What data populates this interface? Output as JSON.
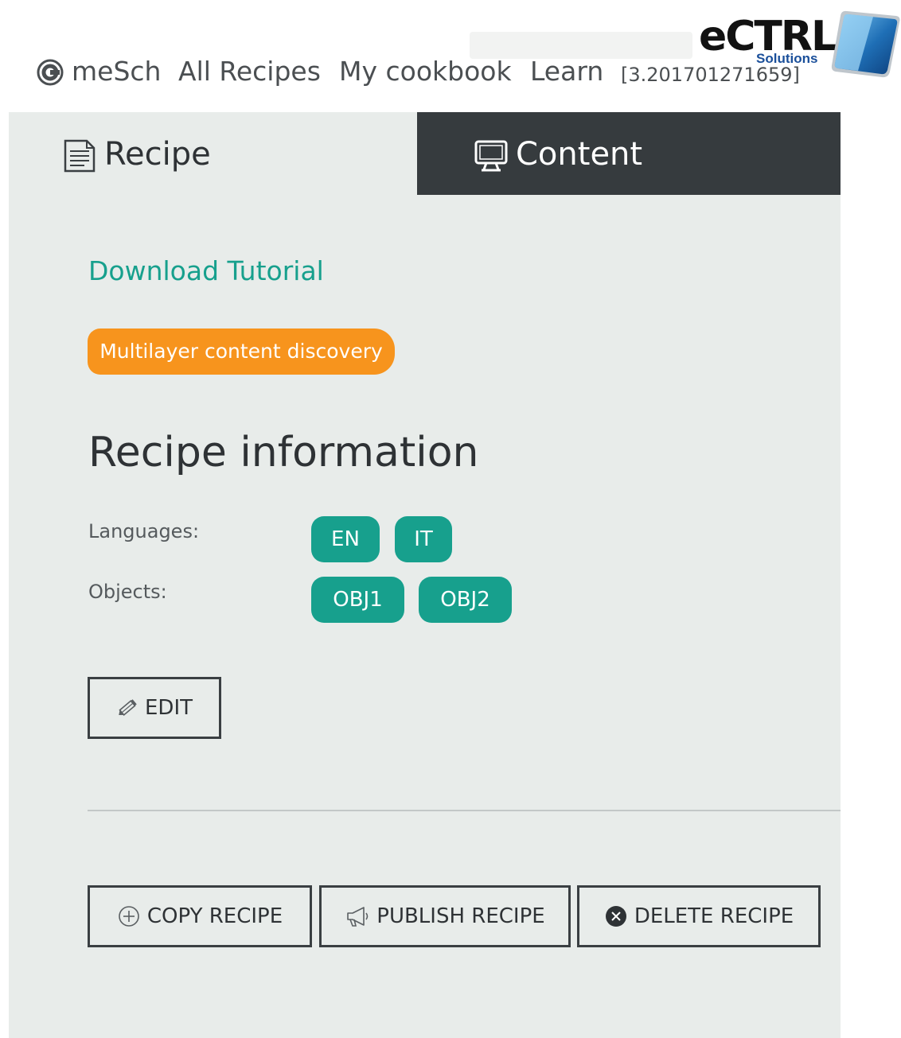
{
  "nav": {
    "brand_label": "meSch",
    "items": [
      "All Recipes",
      "My cookbook",
      "Learn"
    ],
    "version": "[3.201701271659]"
  },
  "watermark": {
    "brand": "eCTRL",
    "sub": "Solutions"
  },
  "tabs": {
    "recipe_label": "Recipe",
    "content_label": "Content",
    "active": "recipe"
  },
  "main": {
    "download_link": "Download Tutorial",
    "category_pill": "Multilayer content discovery",
    "section_title": "Recipe information",
    "languages_label": "Languages:",
    "languages": [
      "EN",
      "IT"
    ],
    "objects_label": "Objects:",
    "objects": [
      "OBJ1",
      "OBJ2"
    ],
    "edit_label": "EDIT"
  },
  "actions": {
    "copy_label": "COPY RECIPE",
    "publish_label": "PUBLISH RECIPE",
    "delete_label": "DELETE RECIPE"
  },
  "colors": {
    "accent": "#17a08d",
    "orange": "#f7941d",
    "tab_dark": "#363b3e",
    "panel_bg": "#e8ecea"
  },
  "icons": {
    "nav_logo": "mesch-logo-icon",
    "recipe_tab": "document-icon",
    "content_tab": "monitor-icon",
    "edit": "pencil-icon",
    "copy": "plus-circle-icon",
    "publish": "megaphone-icon",
    "delete": "close-circle-icon"
  }
}
